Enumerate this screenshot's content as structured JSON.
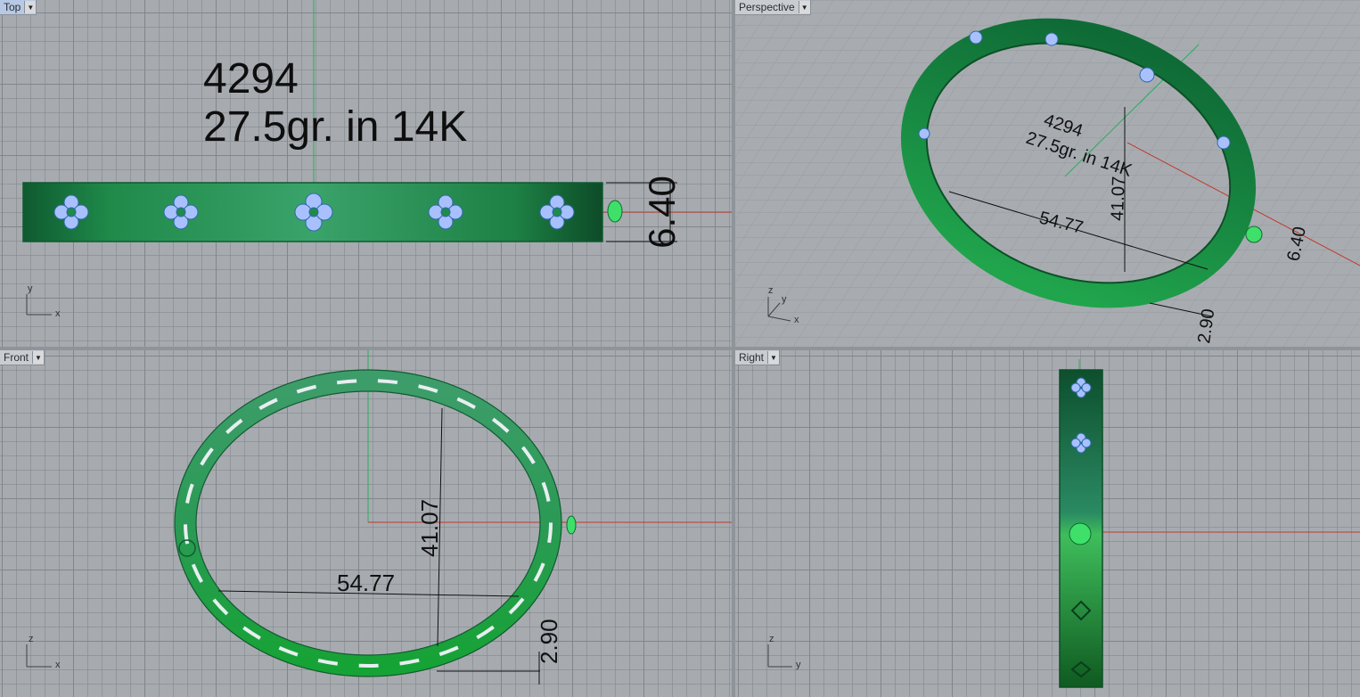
{
  "viewports": {
    "top": {
      "label": "Top"
    },
    "perspective": {
      "label": "Perspective"
    },
    "front": {
      "label": "Front"
    },
    "right": {
      "label": "Right"
    }
  },
  "annotation": {
    "model_number": "4294",
    "weight_text": "27.5gr. in 14K"
  },
  "dimensions": {
    "height": "6.40",
    "width": "54.77",
    "depth": "41.07",
    "thickness": "2.90"
  },
  "axes": {
    "top": [
      "y",
      "x"
    ],
    "perspective": [
      "z",
      "y",
      "x"
    ],
    "front": [
      "z",
      "x"
    ],
    "right": [
      "z",
      "y"
    ]
  },
  "colors": {
    "viewport_bg": "#a7abb0",
    "band_green": "#1f8a4a",
    "stone_blue": "#9fb8ff",
    "axis_red": "#c0392b",
    "axis_green": "#27ae60",
    "active_label": "#b7c9e4"
  }
}
